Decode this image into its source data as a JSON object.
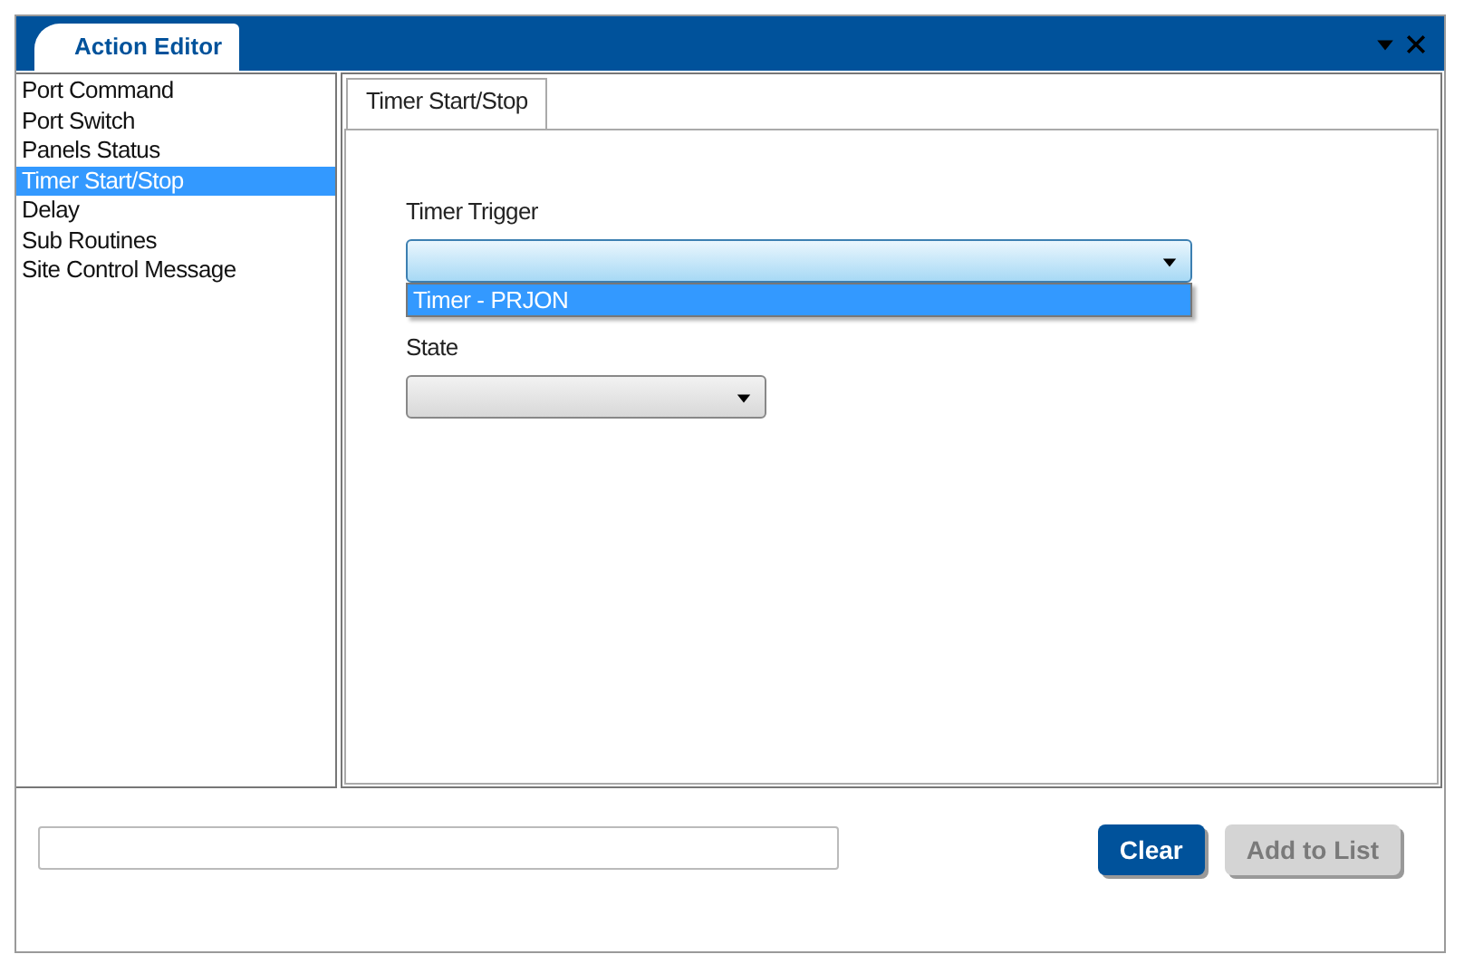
{
  "window": {
    "title": "Action Editor"
  },
  "action_list": [
    {
      "label": "Port Command",
      "selected": false
    },
    {
      "label": "Port Switch",
      "selected": false
    },
    {
      "label": "Panels Status",
      "selected": false
    },
    {
      "label": "Timer Start/Stop",
      "selected": true
    },
    {
      "label": "Delay",
      "selected": false
    },
    {
      "label": "Sub Routines",
      "selected": false
    },
    {
      "label": "Site Control Message",
      "selected": false
    }
  ],
  "tabs": [
    {
      "label": "Timer Start/Stop",
      "selected": true
    }
  ],
  "fields": [
    {
      "label": "Timer Trigger",
      "kind": "wide",
      "expanded": true,
      "options": [
        {
          "label": "Timer - PRJON",
          "selected": true
        }
      ]
    },
    {
      "label": "State",
      "kind": "narrow",
      "expanded": false
    }
  ],
  "buttons": [
    {
      "label": "Clear",
      "disabled": false
    },
    {
      "label": "Add to List",
      "disabled": true
    }
  ]
}
